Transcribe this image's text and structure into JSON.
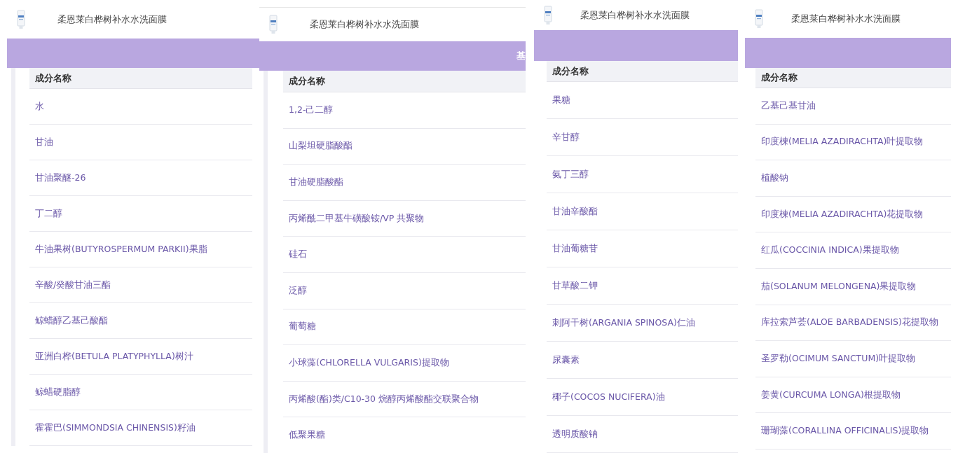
{
  "panels": [
    {
      "title": "柔恩莱白桦树补水水洗面膜",
      "column_header": "成分名称",
      "rows": [
        "水",
        "甘油",
        "甘油聚醚-26",
        "丁二醇",
        "牛油果树(BUTYROSPERMUM PARKII)果脂",
        "辛酸/癸酸甘油三酯",
        "鲸蜡醇乙基己酸酯",
        "亚洲白桦(BETULA PLATYPHYLLA)树汁",
        "鲸蜡硬脂醇",
        "霍霍巴(SIMMONDSIA CHINENSIS)籽油"
      ]
    },
    {
      "title": "柔恩莱白桦树补水水洗面膜",
      "banner_text": "基",
      "column_header": "成分名称",
      "rows": [
        "1,2-己二醇",
        "山梨坦硬脂酸酯",
        "甘油硬脂酸酯",
        "丙烯酰二甲基牛磺酸铵/VP 共聚物",
        "硅石",
        "泛醇",
        "葡萄糖",
        "小球藻(CHLORELLA VULGARIS)提取物",
        "丙烯酸(酯)类/C10-30 烷醇丙烯酸酯交联聚合物",
        "低聚果糖"
      ]
    },
    {
      "title": "柔恩莱白桦树补水水洗面膜",
      "column_header": "成分名称",
      "rows": [
        "果糖",
        "辛甘醇",
        "氨丁三醇",
        "甘油辛酸酯",
        "甘油葡糖苷",
        "甘草酸二钾",
        "刺阿干树(ARGANIA SPINOSA)仁油",
        "尿囊素",
        "椰子(COCOS NUCIFERA)油",
        "透明质酸钠"
      ]
    },
    {
      "title": "柔恩莱白桦树补水水洗面膜",
      "column_header": "成分名称",
      "rows": [
        "乙基己基甘油",
        "印度楝(MELIA AZADIRACHTA)叶提取物",
        "植酸钠",
        "印度楝(MELIA AZADIRACHTA)花提取物",
        "红瓜(COCCINIA INDICA)果提取物",
        "茄(SOLANUM MELONGENA)果提取物",
        "库拉索芦荟(ALOE BARBADENSIS)花提取物",
        "圣罗勒(OCIMUM SANCTUM)叶提取物",
        "姜黄(CURCUMA LONGA)根提取物",
        "珊瑚藻(CORALLINA OFFICINALIS)提取物"
      ]
    }
  ]
}
